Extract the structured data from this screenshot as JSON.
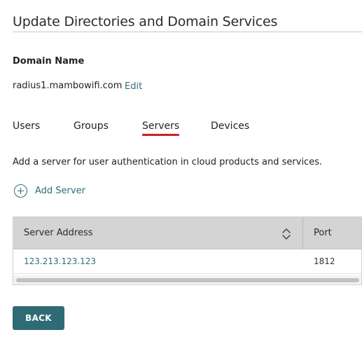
{
  "header": {
    "title": "Update Directories and Domain Services"
  },
  "domain": {
    "label": "Domain Name",
    "value": "radius1.mambowifi.com",
    "edit_label": "Edit"
  },
  "tabs": [
    {
      "label": "Users",
      "active": false
    },
    {
      "label": "Groups",
      "active": false
    },
    {
      "label": "Servers",
      "active": true
    },
    {
      "label": "Devices",
      "active": false
    }
  ],
  "servers": {
    "description": "Add a server for user authentication in cloud products and services.",
    "add_label": "Add Server",
    "add_icon": "plus-circle-icon",
    "table": {
      "columns": [
        "Server Address",
        "Port"
      ],
      "sort_icon": "sort-updown-icon",
      "rows": [
        {
          "address": "123.213.123.123",
          "port": "1812"
        }
      ]
    }
  },
  "footer": {
    "back_label": "BACK"
  },
  "colors": {
    "accent": "#2f6b74",
    "link": "#2f6f7a",
    "active_tab_underline": "#d7192b",
    "table_header_bg": "#d4d4d4"
  }
}
